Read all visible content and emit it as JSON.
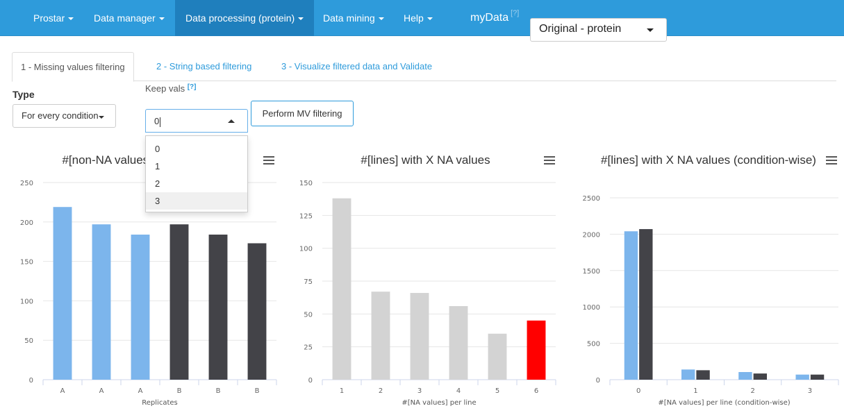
{
  "navbar": {
    "items": [
      {
        "label": "Prostar",
        "dropdown": true
      },
      {
        "label": "Data manager",
        "dropdown": true
      },
      {
        "label": "Data processing (protein)",
        "dropdown": true,
        "active": true
      },
      {
        "label": "Data mining",
        "dropdown": true
      },
      {
        "label": "Help",
        "dropdown": true
      }
    ],
    "mydata_label": "myData",
    "help_marker": "[?]",
    "dataset_selected": "Original - protein"
  },
  "tabs": [
    {
      "label": "1 - Missing values filtering",
      "active": true
    },
    {
      "label": "2 - String based filtering"
    },
    {
      "label": "3 - Visualize filtered data and Validate"
    }
  ],
  "filters": {
    "type_label": "Type",
    "type_value": "For every condition",
    "keep_label": "Keep vals",
    "keep_help": "[?]",
    "keep_value": "0",
    "keep_options": [
      "0",
      "1",
      "2",
      "3"
    ],
    "perform_button": "Perform MV filtering"
  },
  "colors": {
    "navbar": "#2e9bdb",
    "condition_a": "#7cb5ec",
    "condition_b": "#434348",
    "grey_bar": "#d3d3d3",
    "highlight_bar": "#ff0000"
  },
  "chart_data": [
    {
      "type": "bar",
      "title": "#[non-NA values] by replicate",
      "xlabel": "Replicates",
      "ylabel": "",
      "categories": [
        "A",
        "A",
        "A",
        "B",
        "B",
        "B"
      ],
      "values": [
        219,
        197,
        184,
        197,
        184,
        173
      ],
      "bar_colors": [
        "#7cb5ec",
        "#7cb5ec",
        "#7cb5ec",
        "#434348",
        "#434348",
        "#434348"
      ],
      "ylim": [
        0,
        250
      ],
      "yticks": [
        0,
        50,
        100,
        150,
        200,
        250
      ],
      "grid": true
    },
    {
      "type": "bar",
      "title": "#[lines] with X NA values",
      "xlabel": "#[NA values] per line",
      "ylabel": "",
      "categories": [
        "1",
        "2",
        "3",
        "4",
        "5",
        "6"
      ],
      "values": [
        138,
        67,
        66,
        56,
        35,
        45
      ],
      "bar_colors": [
        "#d3d3d3",
        "#d3d3d3",
        "#d3d3d3",
        "#d3d3d3",
        "#d3d3d3",
        "#ff0000"
      ],
      "ylim": [
        0,
        150
      ],
      "yticks": [
        0,
        25,
        50,
        75,
        100,
        125,
        150
      ],
      "grid": true
    },
    {
      "type": "bar",
      "title": "#[lines] with X NA values (condition-wise)",
      "xlabel": "#[NA values] per line (condition-wise)",
      "ylabel": "",
      "categories": [
        "0",
        "1",
        "2",
        "3"
      ],
      "series": [
        {
          "values": [
            2040,
            140,
            105,
            70
          ],
          "color": "#7cb5ec"
        },
        {
          "values": [
            2070,
            130,
            85,
            70
          ],
          "color": "#434348"
        }
      ],
      "ylim": [
        0,
        2500
      ],
      "yticks": [
        0,
        500,
        1000,
        1500,
        2000,
        2500
      ],
      "grid": true
    }
  ]
}
